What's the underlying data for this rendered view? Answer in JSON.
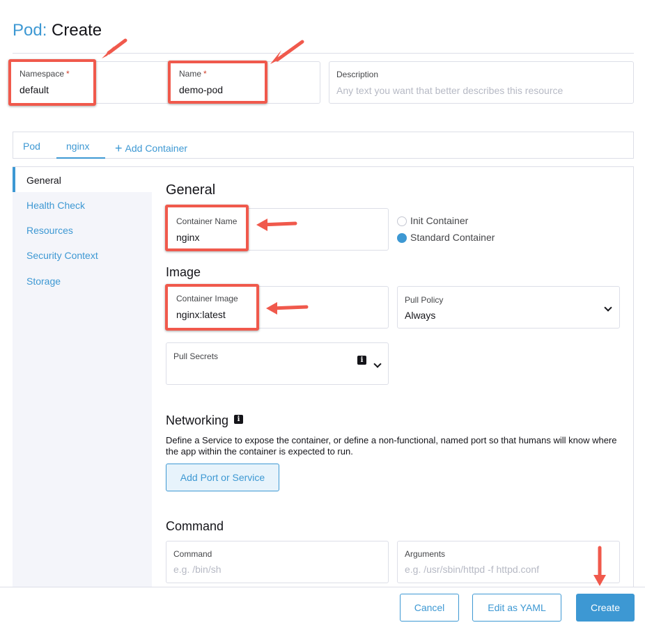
{
  "header": {
    "resource": "Pod:",
    "action": "Create"
  },
  "namespace": {
    "label": "Namespace",
    "required": "*",
    "value": "default"
  },
  "name": {
    "label": "Name",
    "required": "*",
    "value": "demo-pod"
  },
  "description": {
    "label": "Description",
    "placeholder": "Any text you want that better describes this resource"
  },
  "tabs": [
    {
      "label": "Pod"
    },
    {
      "label": "nginx"
    },
    {
      "label": "Add Container"
    }
  ],
  "sidebar": {
    "items": [
      {
        "label": "General"
      },
      {
        "label": "Health Check"
      },
      {
        "label": "Resources"
      },
      {
        "label": "Security Context"
      },
      {
        "label": "Storage"
      }
    ]
  },
  "general": {
    "title": "General",
    "container_name": {
      "label": "Container Name",
      "value": "nginx"
    },
    "init_container": "Init Container",
    "standard_container": "Standard Container"
  },
  "image": {
    "title": "Image",
    "container_image": {
      "label": "Container Image",
      "value": "nginx:latest"
    },
    "pull_policy": {
      "label": "Pull Policy",
      "value": "Always"
    },
    "pull_secrets": {
      "label": "Pull Secrets"
    }
  },
  "networking": {
    "title": "Networking",
    "description": "Define a Service to expose the container, or define a non-functional, named port so that humans will know where the app within the container is expected to run.",
    "add_button": "Add Port or Service"
  },
  "command": {
    "title": "Command",
    "command": {
      "label": "Command",
      "placeholder": "e.g. /bin/sh"
    },
    "arguments": {
      "label": "Arguments",
      "placeholder": "e.g. /usr/sbin/httpd -f httpd.conf"
    }
  },
  "footer": {
    "cancel": "Cancel",
    "edit_yaml": "Edit as YAML",
    "create": "Create"
  },
  "colors": {
    "accent": "#3d98d3",
    "annotation": "#f0594c",
    "required": "#d0402c"
  },
  "icons": {
    "plus": "plus-icon",
    "info": "info-icon",
    "chevron": "chevron-down-icon"
  }
}
